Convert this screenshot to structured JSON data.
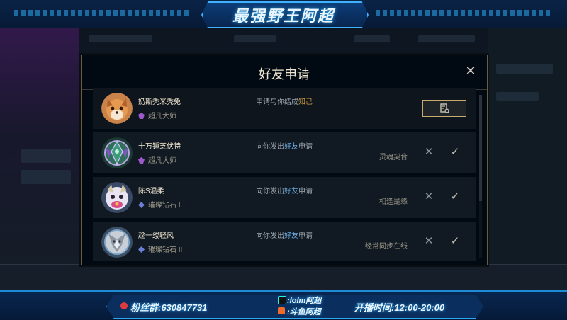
{
  "stream_banner": {
    "title": "最强野王阿超"
  },
  "modal": {
    "title": "好友申请",
    "close_label": "✕",
    "requests": [
      {
        "name": "奶斯秃米秃兔",
        "rank": "超凡大师",
        "request_prefix": "申请与你结成",
        "request_highlight": "知己",
        "note": "",
        "action": "view-profile",
        "avatar_icon": "fox-avatar-icon"
      },
      {
        "name": "十万锤芝伏特",
        "rank": "超凡大师",
        "request_prefix": "向你发出",
        "request_highlight": "好友",
        "request_suffix": "申请",
        "note": "灵魂契合",
        "avatar_icon": "crest-avatar-icon"
      },
      {
        "name": "陈S温柔",
        "rank": "璀璨钻石 I",
        "request_prefix": "向你发出",
        "request_highlight": "好友",
        "request_suffix": "申请",
        "note": "相逢是缘",
        "avatar_icon": "poro-avatar-icon"
      },
      {
        "name": "趁一缕轻风",
        "rank": "璀璨钻石 II",
        "request_prefix": "向你发出",
        "request_highlight": "好友",
        "request_suffix": "申请",
        "note": "经常同步在线",
        "avatar_icon": "dragon-avatar-icon"
      }
    ],
    "decline_glyph": "✕",
    "accept_glyph": "✓"
  },
  "footer": {
    "fans_group": "粉丝群:630847731",
    "douyin": ":lolm阿超",
    "douyu": ":斗鱼阿超",
    "live_time": "开播时间:12:00-20:00"
  },
  "colors": {
    "gold_accent": "#c89b3c",
    "blue_highlight": "#6aa8e0",
    "modal_border": "#6a5d3b",
    "banner_blue": "#1e8bd6"
  }
}
